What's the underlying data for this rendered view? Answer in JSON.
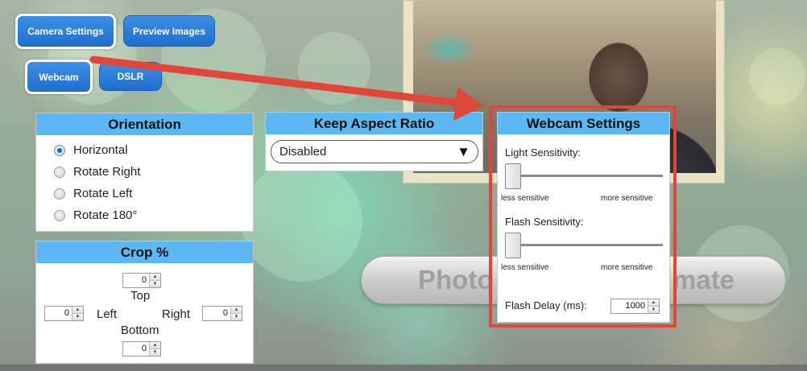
{
  "nav": {
    "camera_settings": "Camera Settings",
    "preview_images": "Preview Images",
    "webcam": "Webcam",
    "dslr": "DSLR"
  },
  "orientation": {
    "title": "Orientation",
    "options": [
      "Horizontal",
      "Rotate Right",
      "Rotate Left",
      "Rotate 180°"
    ],
    "selected": "Horizontal"
  },
  "crop": {
    "title": "Crop %",
    "top_label": "Top",
    "left_label": "Left",
    "right_label": "Right",
    "bottom_label": "Bottom",
    "top": "0",
    "left": "0",
    "right": "0",
    "bottom": "0"
  },
  "aspect": {
    "title": "Keep Aspect Ratio",
    "value": "Disabled"
  },
  "webcam_settings": {
    "title": "Webcam Settings",
    "light_label": "Light Sensitivity:",
    "flash_label": "Flash Sensitivity:",
    "less": "less sensitive",
    "more": "more sensitive",
    "delay_label": "Flash Delay (ms):",
    "delay_value": "1000",
    "light_level": 0,
    "flash_level": 0
  },
  "booth_button": {
    "left_text": "Photo",
    "right_text": "mate"
  },
  "colors": {
    "header": "#5cb8f2",
    "button": "#1f6fd0",
    "highlight": "#e0463a"
  }
}
